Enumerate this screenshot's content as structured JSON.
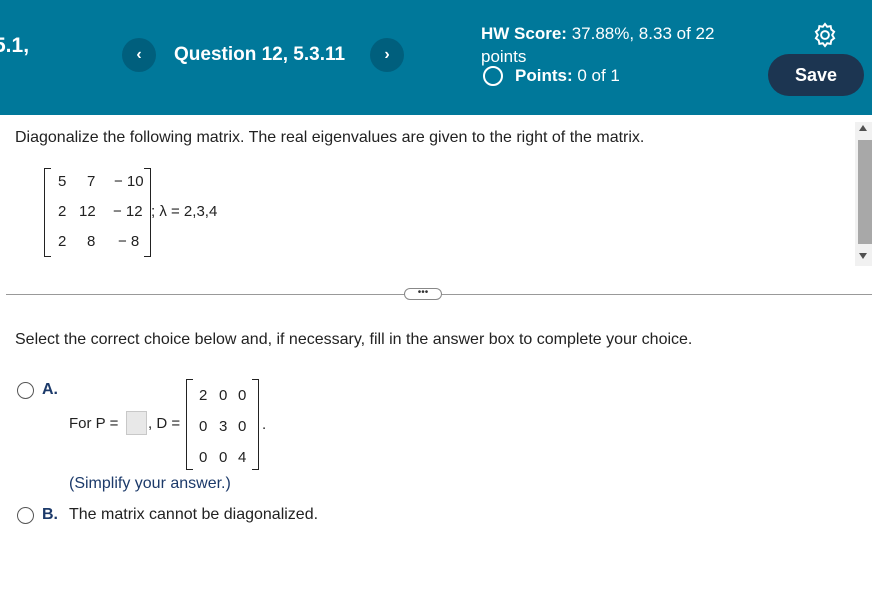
{
  "header": {
    "section": "5.1,",
    "prev_icon": "‹",
    "next_icon": "›",
    "question_title": "Question 12, 5.3.11",
    "hw_score_label": "HW Score:",
    "hw_score_value": "37.88%, 8.33 of 22",
    "hw_score_unit": "points",
    "points_label": "Points:",
    "points_value": "0 of 1",
    "save_label": "Save"
  },
  "question": {
    "instruction": "Diagonalize the following matrix. The real eigenvalues are given to the right of the matrix.",
    "matrix": [
      [
        "5",
        "7",
        "− 10"
      ],
      [
        "2",
        "12",
        "− 12"
      ],
      [
        "2",
        "8",
        "− 8"
      ]
    ],
    "eigen_text": "; λ = 2,3,4",
    "ellipsis": "•••"
  },
  "answer": {
    "select_text": "Select the correct choice below and, if necessary, fill in the answer box to complete your choice.",
    "option_a": {
      "label": "A.",
      "for_p": "For P =",
      "d_eq": ", D =",
      "d_matrix": [
        [
          "2",
          "0",
          "0"
        ],
        [
          "0",
          "3",
          "0"
        ],
        [
          "0",
          "0",
          "4"
        ]
      ],
      "period": ".",
      "simplify": "(Simplify your answer.)"
    },
    "option_b": {
      "label": "B.",
      "text": "The matrix cannot be diagonalized."
    }
  }
}
